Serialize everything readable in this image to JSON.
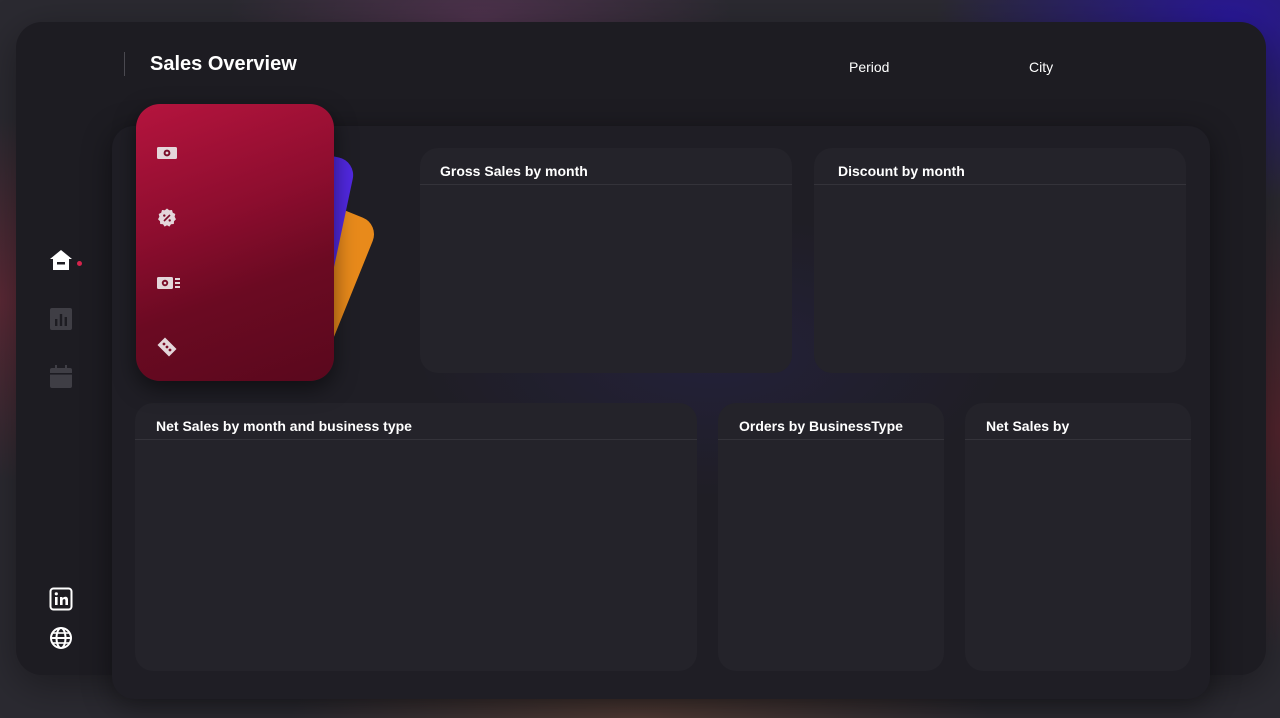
{
  "header": {
    "title": "Sales Overview",
    "filters": {
      "period_label": "Period",
      "city_label": "City"
    }
  },
  "nav": {
    "items": [
      {
        "icon": "home-icon",
        "active": true
      },
      {
        "icon": "bar-chart-icon",
        "active": false
      },
      {
        "icon": "calendar-icon",
        "active": false
      }
    ],
    "footer": [
      {
        "icon": "linkedin-icon"
      },
      {
        "icon": "globe-icon"
      }
    ],
    "active_color": "#d6244c"
  },
  "kpi_card": {
    "icons": [
      "cash-icon",
      "discount-icon",
      "net-sales-icon",
      "ticket-icon"
    ],
    "colors": {
      "front": "#b5143e",
      "mid": "#5128e0",
      "back": "#e88a1b"
    }
  },
  "visuals": {
    "gross_sales": {
      "title": "Gross Sales by month"
    },
    "discount": {
      "title": "Discount by month"
    },
    "net_sales_business": {
      "title": "Net Sales by month and business type"
    },
    "orders_business": {
      "title": "Orders by BusinessType"
    },
    "net_sales_by": {
      "title": "Net Sales by"
    }
  }
}
